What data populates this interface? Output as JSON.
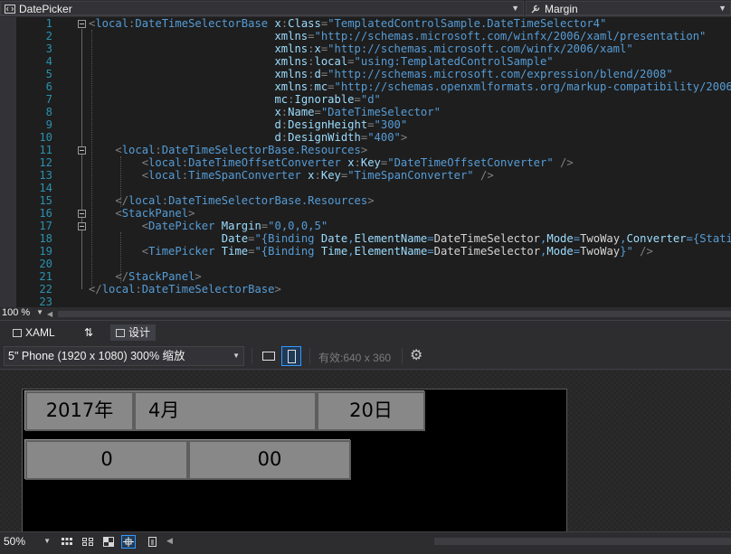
{
  "nav": {
    "left_label": "DatePicker",
    "right_label": "Margin"
  },
  "editor": {
    "line_numbers": [
      "1",
      "2",
      "3",
      "4",
      "5",
      "6",
      "7",
      "8",
      "9",
      "10",
      "11",
      "12",
      "13",
      "14",
      "15",
      "16",
      "17",
      "18",
      "19",
      "20",
      "21",
      "22",
      "23"
    ],
    "zoom": "100 %"
  },
  "tabs": {
    "xaml": "XAML",
    "swap": "⇅",
    "design": "设计"
  },
  "toolbar": {
    "device": "5\" Phone (1920 x 1080) 300% 缩放",
    "effective_size": "有效:640 x 360"
  },
  "date_picker": {
    "year": "2017年",
    "month": "4月",
    "day": "20日"
  },
  "time_picker": {
    "hour": "0",
    "minute": "00"
  },
  "designer": {
    "zoom": "50%"
  },
  "colors": {
    "accent": "#3399ff",
    "picker_bg": "#888888",
    "editor_bg": "#1e1e1e",
    "line_number": "#2b91af"
  }
}
